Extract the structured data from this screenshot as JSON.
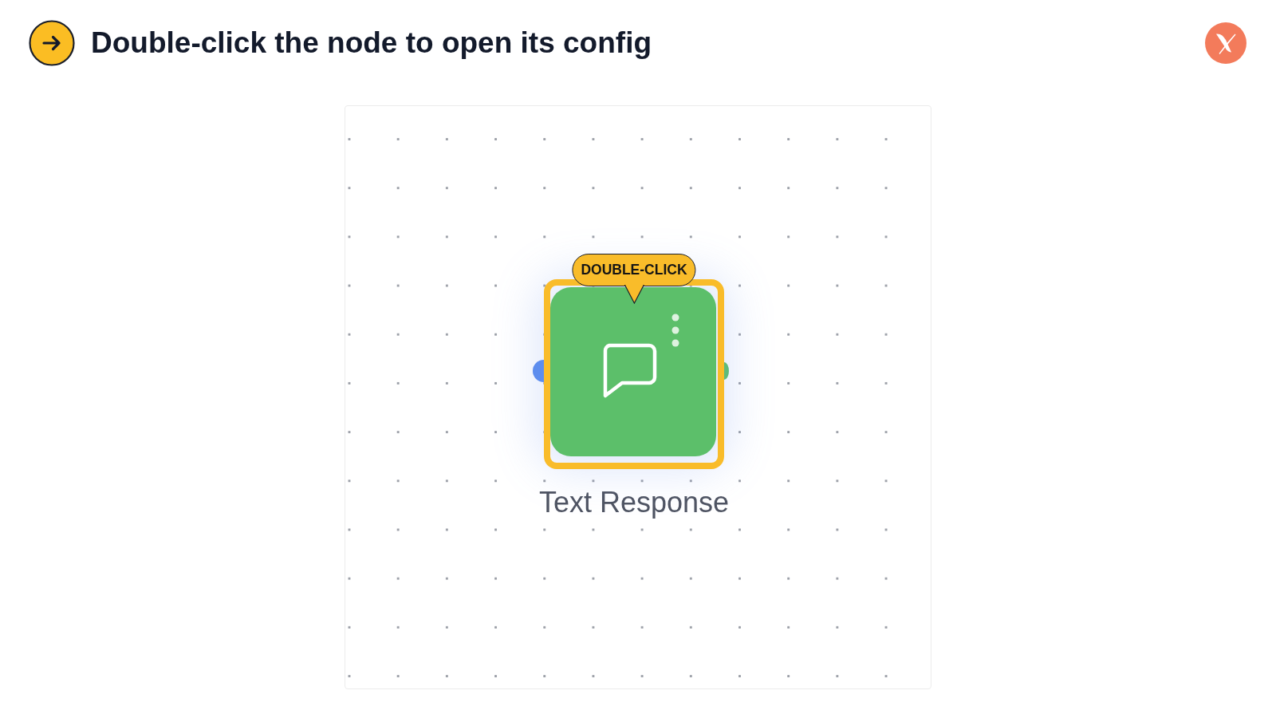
{
  "header": {
    "title": "Double-click the node to open its config"
  },
  "canvas": {
    "node": {
      "label": "Text Response",
      "badge": "DOUBLE-CLICK",
      "highlighted": true
    }
  }
}
